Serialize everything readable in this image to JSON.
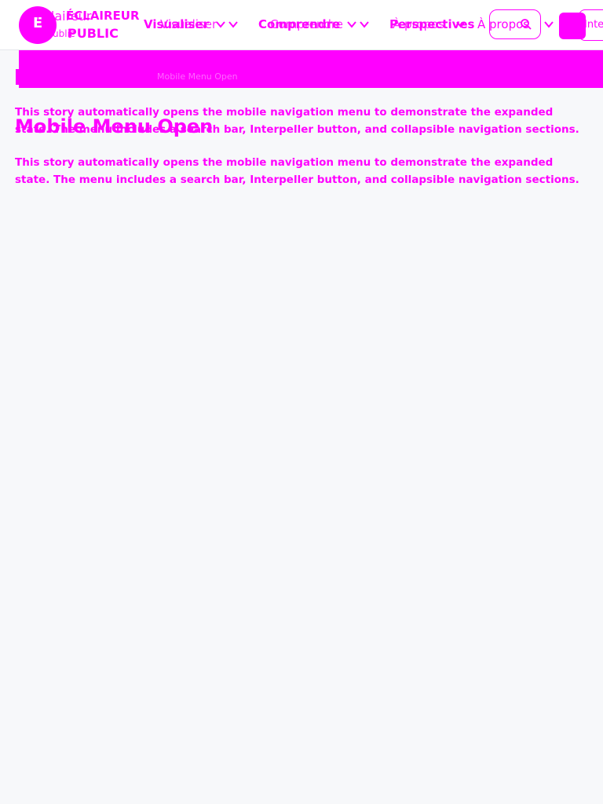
{
  "brand": {
    "logo_letter": "E",
    "line1": "ÉCLAIREUR",
    "line2": "PUBLIC",
    "ghost1": "Éclaireur",
    "ghost2": "Public",
    "accent_color": "#ff00ff"
  },
  "nav": {
    "visualiser_label": "Visualiser",
    "comprendre_label": "Comprendre",
    "perspectives_label": "Perspectives",
    "apropos_label": "À propos",
    "interpeller_label": "Interpeller"
  },
  "story": {
    "title": "Mobile Menu Open",
    "description": "This story automatically opens the mobile navigation menu to demonstrate the expanded state. The menu includes a search bar, Interpeller button, and collapsible navigation sections."
  }
}
